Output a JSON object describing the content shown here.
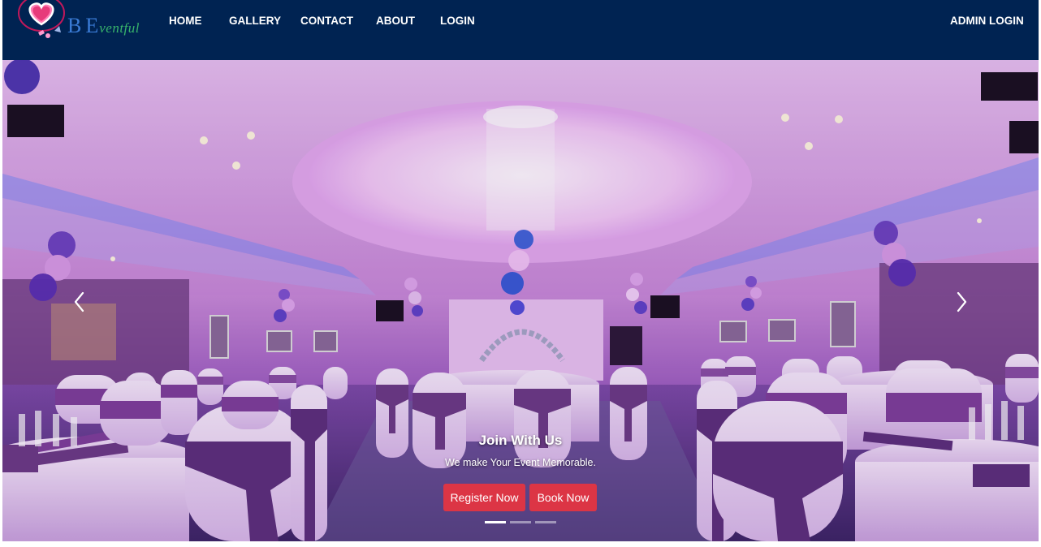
{
  "brand": {
    "logo_letter": "B",
    "logo_letter_2": "E",
    "logo_subtext": "ventful"
  },
  "nav": {
    "links": [
      "HOME",
      "GALLERY",
      "CONTACT",
      "ABOUT",
      "LOGIN"
    ],
    "admin_login": "ADMIN LOGIN"
  },
  "hero": {
    "caption_title": "Join With Us",
    "caption_subtitle": "We make Your Event Memorable.",
    "register_button": "Register Now",
    "book_button": "Book Now",
    "indicator_count": 3,
    "active_indicator": 0,
    "prev_icon": "chevron-left-icon",
    "next_icon": "chevron-right-icon"
  },
  "colors": {
    "navbar": "#002352",
    "button": "#dc3545",
    "logo_heart": "#e73b7a"
  }
}
